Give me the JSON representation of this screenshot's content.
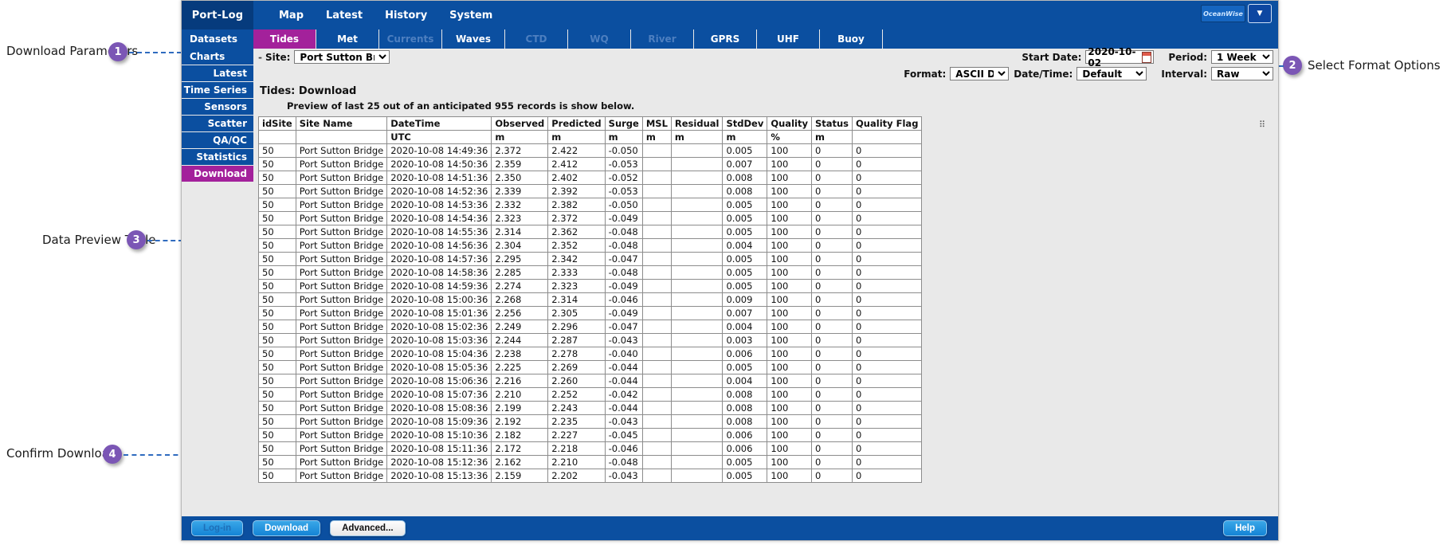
{
  "annotations": [
    {
      "id": "1",
      "label": "Download Parameters"
    },
    {
      "id": "2",
      "label": "Select Format Options"
    },
    {
      "id": "3",
      "label": "Data Preview Table"
    },
    {
      "id": "4",
      "label": "Confirm Download"
    }
  ],
  "topbar": {
    "brand": "Port-Log",
    "menu": [
      "Map",
      "Latest",
      "History",
      "System"
    ],
    "logo_text": "OceanWise",
    "dropdown_icon": "chevron-down-icon"
  },
  "tabrow": {
    "datasets_label": "Datasets",
    "tabs": [
      {
        "label": "Tides",
        "state": "active"
      },
      {
        "label": "Met",
        "state": "enabled"
      },
      {
        "label": "Currents",
        "state": "disabled"
      },
      {
        "label": "Waves",
        "state": "enabled"
      },
      {
        "label": "CTD",
        "state": "disabled"
      },
      {
        "label": "WQ",
        "state": "disabled"
      },
      {
        "label": "River",
        "state": "disabled"
      },
      {
        "label": "GPRS",
        "state": "enabled"
      },
      {
        "label": "UHF",
        "state": "enabled"
      },
      {
        "label": "Buoy",
        "state": "enabled"
      }
    ]
  },
  "sidebar": {
    "items": [
      {
        "label": "Charts",
        "state": "normal"
      },
      {
        "label": "Latest",
        "state": "normal"
      },
      {
        "label": "Time Series",
        "state": "normal"
      },
      {
        "label": "Sensors",
        "state": "normal"
      },
      {
        "label": "Scatter",
        "state": "normal"
      },
      {
        "label": "QA/QC",
        "state": "normal"
      },
      {
        "label": "Statistics",
        "state": "normal"
      },
      {
        "label": "Download",
        "state": "active"
      }
    ]
  },
  "params": {
    "site_label": "Site:",
    "site_value": "Port Sutton Bridge",
    "start_date_label": "Start Date:",
    "start_date_value": "2020-10-02",
    "calendar_icon": "calendar-icon",
    "period_label": "Period:",
    "period_value": "1 Week",
    "format_label": "Format:",
    "format_value": "ASCII Deli",
    "datetime_label": "Date/Time:",
    "datetime_value": "Default",
    "interval_label": "Interval:",
    "interval_value": "Raw"
  },
  "main": {
    "title": "Tides: Download",
    "preview_note": "Preview of last 25 out of an anticipated 955 records is show below.",
    "resize_icon": "resize-handle-icon"
  },
  "table": {
    "headers": [
      "idSite",
      "Site Name",
      "DateTime",
      "Observed",
      "Predicted",
      "Surge",
      "MSL",
      "Residual",
      "StdDev",
      "Quality",
      "Status",
      "Quality Flag"
    ],
    "units": [
      "",
      "",
      "UTC",
      "m",
      "m",
      "m",
      "m",
      "m",
      "m",
      "%",
      "m",
      ""
    ],
    "rows": [
      [
        "50",
        "Port Sutton Bridge",
        "2020-10-08 14:49:36",
        "2.372",
        "2.422",
        "-0.050",
        "",
        "",
        "0.005",
        "100",
        "0",
        "0"
      ],
      [
        "50",
        "Port Sutton Bridge",
        "2020-10-08 14:50:36",
        "2.359",
        "2.412",
        "-0.053",
        "",
        "",
        "0.007",
        "100",
        "0",
        "0"
      ],
      [
        "50",
        "Port Sutton Bridge",
        "2020-10-08 14:51:36",
        "2.350",
        "2.402",
        "-0.052",
        "",
        "",
        "0.008",
        "100",
        "0",
        "0"
      ],
      [
        "50",
        "Port Sutton Bridge",
        "2020-10-08 14:52:36",
        "2.339",
        "2.392",
        "-0.053",
        "",
        "",
        "0.008",
        "100",
        "0",
        "0"
      ],
      [
        "50",
        "Port Sutton Bridge",
        "2020-10-08 14:53:36",
        "2.332",
        "2.382",
        "-0.050",
        "",
        "",
        "0.005",
        "100",
        "0",
        "0"
      ],
      [
        "50",
        "Port Sutton Bridge",
        "2020-10-08 14:54:36",
        "2.323",
        "2.372",
        "-0.049",
        "",
        "",
        "0.005",
        "100",
        "0",
        "0"
      ],
      [
        "50",
        "Port Sutton Bridge",
        "2020-10-08 14:55:36",
        "2.314",
        "2.362",
        "-0.048",
        "",
        "",
        "0.005",
        "100",
        "0",
        "0"
      ],
      [
        "50",
        "Port Sutton Bridge",
        "2020-10-08 14:56:36",
        "2.304",
        "2.352",
        "-0.048",
        "",
        "",
        "0.004",
        "100",
        "0",
        "0"
      ],
      [
        "50",
        "Port Sutton Bridge",
        "2020-10-08 14:57:36",
        "2.295",
        "2.342",
        "-0.047",
        "",
        "",
        "0.005",
        "100",
        "0",
        "0"
      ],
      [
        "50",
        "Port Sutton Bridge",
        "2020-10-08 14:58:36",
        "2.285",
        "2.333",
        "-0.048",
        "",
        "",
        "0.005",
        "100",
        "0",
        "0"
      ],
      [
        "50",
        "Port Sutton Bridge",
        "2020-10-08 14:59:36",
        "2.274",
        "2.323",
        "-0.049",
        "",
        "",
        "0.005",
        "100",
        "0",
        "0"
      ],
      [
        "50",
        "Port Sutton Bridge",
        "2020-10-08 15:00:36",
        "2.268",
        "2.314",
        "-0.046",
        "",
        "",
        "0.009",
        "100",
        "0",
        "0"
      ],
      [
        "50",
        "Port Sutton Bridge",
        "2020-10-08 15:01:36",
        "2.256",
        "2.305",
        "-0.049",
        "",
        "",
        "0.007",
        "100",
        "0",
        "0"
      ],
      [
        "50",
        "Port Sutton Bridge",
        "2020-10-08 15:02:36",
        "2.249",
        "2.296",
        "-0.047",
        "",
        "",
        "0.004",
        "100",
        "0",
        "0"
      ],
      [
        "50",
        "Port Sutton Bridge",
        "2020-10-08 15:03:36",
        "2.244",
        "2.287",
        "-0.043",
        "",
        "",
        "0.003",
        "100",
        "0",
        "0"
      ],
      [
        "50",
        "Port Sutton Bridge",
        "2020-10-08 15:04:36",
        "2.238",
        "2.278",
        "-0.040",
        "",
        "",
        "0.006",
        "100",
        "0",
        "0"
      ],
      [
        "50",
        "Port Sutton Bridge",
        "2020-10-08 15:05:36",
        "2.225",
        "2.269",
        "-0.044",
        "",
        "",
        "0.005",
        "100",
        "0",
        "0"
      ],
      [
        "50",
        "Port Sutton Bridge",
        "2020-10-08 15:06:36",
        "2.216",
        "2.260",
        "-0.044",
        "",
        "",
        "0.004",
        "100",
        "0",
        "0"
      ],
      [
        "50",
        "Port Sutton Bridge",
        "2020-10-08 15:07:36",
        "2.210",
        "2.252",
        "-0.042",
        "",
        "",
        "0.008",
        "100",
        "0",
        "0"
      ],
      [
        "50",
        "Port Sutton Bridge",
        "2020-10-08 15:08:36",
        "2.199",
        "2.243",
        "-0.044",
        "",
        "",
        "0.008",
        "100",
        "0",
        "0"
      ],
      [
        "50",
        "Port Sutton Bridge",
        "2020-10-08 15:09:36",
        "2.192",
        "2.235",
        "-0.043",
        "",
        "",
        "0.008",
        "100",
        "0",
        "0"
      ],
      [
        "50",
        "Port Sutton Bridge",
        "2020-10-08 15:10:36",
        "2.182",
        "2.227",
        "-0.045",
        "",
        "",
        "0.006",
        "100",
        "0",
        "0"
      ],
      [
        "50",
        "Port Sutton Bridge",
        "2020-10-08 15:11:36",
        "2.172",
        "2.218",
        "-0.046",
        "",
        "",
        "0.006",
        "100",
        "0",
        "0"
      ],
      [
        "50",
        "Port Sutton Bridge",
        "2020-10-08 15:12:36",
        "2.162",
        "2.210",
        "-0.048",
        "",
        "",
        "0.005",
        "100",
        "0",
        "0"
      ],
      [
        "50",
        "Port Sutton Bridge",
        "2020-10-08 15:13:36",
        "2.159",
        "2.202",
        "-0.043",
        "",
        "",
        "0.005",
        "100",
        "0",
        "0"
      ]
    ]
  },
  "bottombar": {
    "login_label": "Log-in",
    "download_label": "Download",
    "advanced_label": "Advanced...",
    "help_label": "Help"
  },
  "colors": {
    "nav_blue": "#0b4fa0",
    "accent_magenta": "#a3219b",
    "badge_purple": "#7b56b5",
    "dash_blue": "#2f6bbf"
  }
}
